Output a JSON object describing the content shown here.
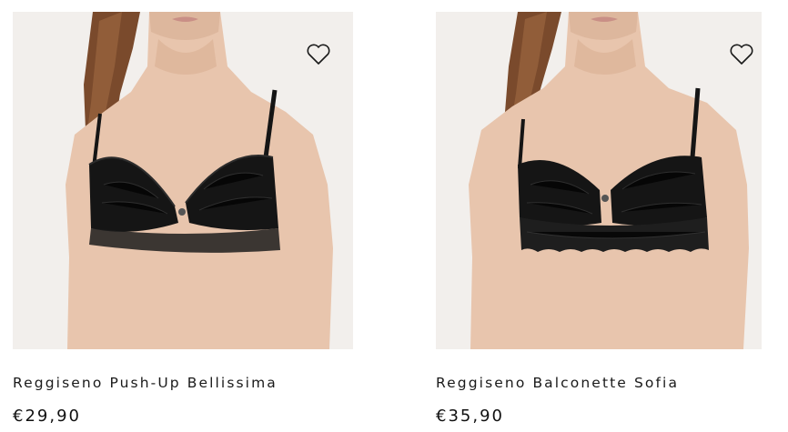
{
  "products": [
    {
      "name": "Reggiseno Push-Up Bellissima",
      "price": "€29,90",
      "wishlist_icon": "heart-outline-icon",
      "image": "black-lace-push-up-bra-photo"
    },
    {
      "name": "Reggiseno Balconette Sofia",
      "price": "€35,90",
      "wishlist_icon": "heart-outline-icon",
      "image": "black-lace-balconette-bra-photo"
    }
  ],
  "colors": {
    "image_background": "#f2efec",
    "skin": "#e8c5ad",
    "hair": "#7a4a2c",
    "garment": "#151515",
    "text": "#1a1a1a"
  }
}
